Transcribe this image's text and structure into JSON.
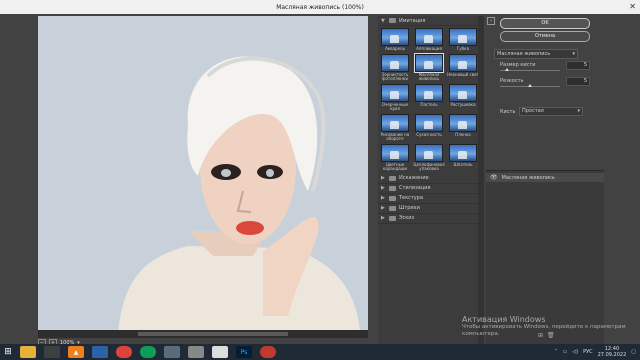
{
  "window": {
    "title": "Масляная живопись (100%)"
  },
  "preview": {
    "zoom": "100%"
  },
  "gallery": {
    "open_group": "Имитация",
    "filters": [
      "Акварель",
      "Аппликация",
      "Губка",
      "Зернистость фотопленки",
      "Масляная живопись",
      "Неоновый свет",
      "Очерченные края",
      "Пастель",
      "Растушевка",
      "Рисование на обороте",
      "Сухая кисть",
      "Пленка",
      "Цветные карандаши",
      "Целлофановая упаковка",
      "Шпатель"
    ],
    "selected_filter": "Масляная живопись",
    "groups": [
      "Искажение",
      "Стилизация",
      "Текстура",
      "Штрихи",
      "Эскиз"
    ]
  },
  "buttons": {
    "ok": "OK",
    "cancel": "Отмена"
  },
  "settings": {
    "filter": "Масляная живопись",
    "brush_size_label": "Размер кисти",
    "brush_size": "5",
    "brush_size_level": 0.1,
    "sharpness_label": "Резкость",
    "sharpness": "5",
    "sharpness_level": 0.5,
    "texture_label": "Кисть",
    "texture": "Простая"
  },
  "layers": {
    "item": "Масляная живопись"
  },
  "activation": {
    "title": "Активация Windows",
    "text": "Чтобы активировать Windows, перейдите к параметрам компьютера."
  },
  "taskbar": {
    "language": "РУС",
    "time": "12:40",
    "date": "27.09.2022"
  }
}
